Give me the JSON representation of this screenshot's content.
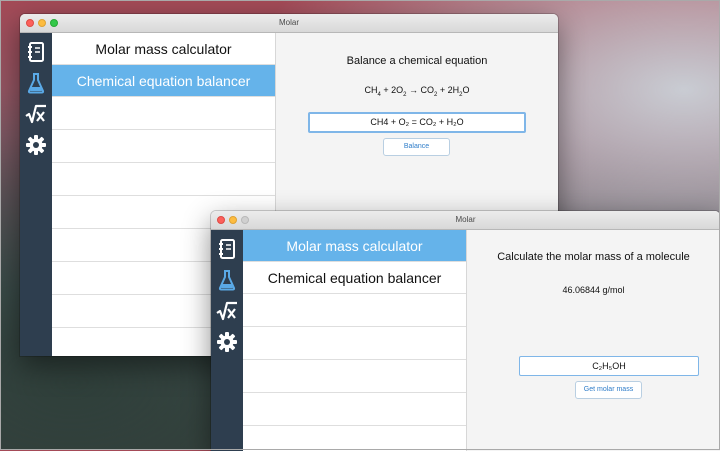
{
  "colors": {
    "sidebar": "#2e3e4f",
    "accent": "#65b3ea",
    "icon_active": "#5aa9e6",
    "icon_inactive": "#ffffff"
  },
  "windows": [
    {
      "title": "Molar",
      "sidebar": [
        {
          "icon": "notebook-icon",
          "active": false
        },
        {
          "icon": "flask-icon",
          "active": true
        },
        {
          "icon": "square-root-x-icon",
          "active": false
        },
        {
          "icon": "gear-icon",
          "active": false
        }
      ],
      "list_items": [
        "Molar mass calculator",
        "Chemical equation balancer"
      ],
      "selected_index": 1,
      "panel": {
        "heading": "Balance a chemical equation",
        "result": {
          "parts": [
            "CH",
            "4",
            " + 2O",
            "2",
            " → CO",
            "2",
            " + 2H",
            "2",
            "O"
          ]
        },
        "input_value": "CH4 + O₂ = CO₂ + H₂O",
        "button_label": "Balance"
      }
    },
    {
      "title": "Molar",
      "sidebar": [
        {
          "icon": "notebook-icon",
          "active": false
        },
        {
          "icon": "flask-icon",
          "active": true
        },
        {
          "icon": "square-root-x-icon",
          "active": false
        },
        {
          "icon": "gear-icon",
          "active": false
        }
      ],
      "list_items": [
        "Molar mass calculator",
        "Chemical equation balancer"
      ],
      "selected_index": 0,
      "panel": {
        "heading": "Calculate the molar mass of a molecule",
        "result": "46.06844 g/mol",
        "input_value": "C₂H₅OH",
        "button_label": "Get molar mass"
      }
    }
  ]
}
